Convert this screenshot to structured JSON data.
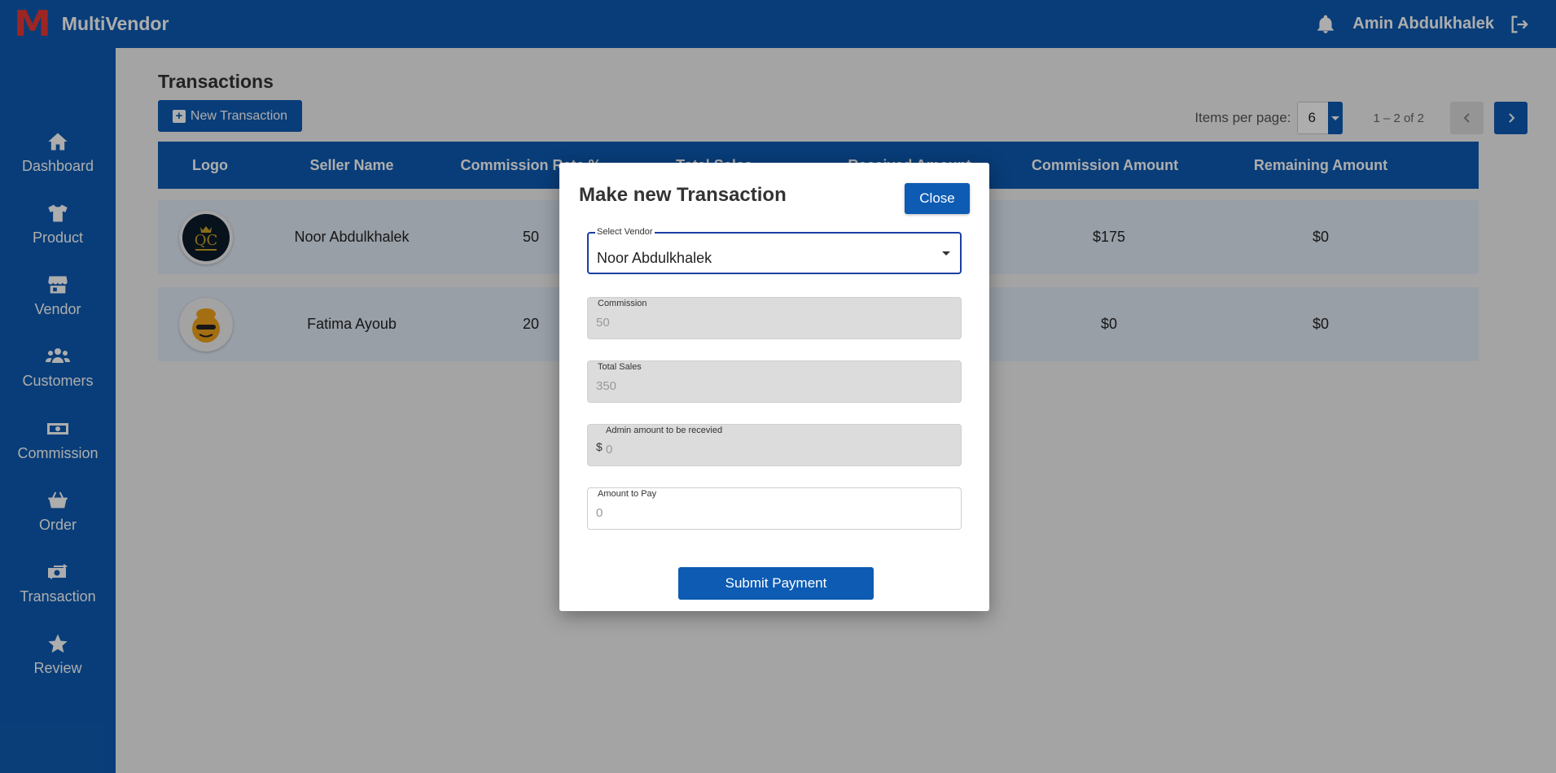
{
  "app": {
    "logo_letter": "M",
    "name": "MultiVendor"
  },
  "header": {
    "user_name": "Amin Abdulkhalek"
  },
  "sidebar": {
    "items": [
      {
        "label": "Dashboard",
        "icon": "home-icon"
      },
      {
        "label": "Product",
        "icon": "shirt-icon"
      },
      {
        "label": "Vendor",
        "icon": "store-icon"
      },
      {
        "label": "Customers",
        "icon": "users-icon"
      },
      {
        "label": "Commission",
        "icon": "money-icon"
      },
      {
        "label": "Order",
        "icon": "basket-icon"
      },
      {
        "label": "Transaction",
        "icon": "money-transfer-icon",
        "active": true
      },
      {
        "label": "Review",
        "icon": "star-icon"
      }
    ]
  },
  "page": {
    "title": "Transactions",
    "new_button": "New Transaction",
    "pager": {
      "items_label": "Items per page:",
      "items_value": "6",
      "range": "1 – 2 of 2"
    }
  },
  "table": {
    "headers": [
      "Logo",
      "Seller Name",
      "Commission Rate %",
      "Total Sales",
      "Received Amount",
      "Commission Amount",
      "Remaining Amount"
    ],
    "rows": [
      {
        "seller": "Noor Abdulkhalek",
        "rate": "50",
        "commission_amount": "$175",
        "remaining": "$0"
      },
      {
        "seller": "Fatima Ayoub",
        "rate": "20",
        "commission_amount": "$0",
        "remaining": "$0"
      }
    ]
  },
  "modal": {
    "title": "Make new Transaction",
    "close": "Close",
    "vendor": {
      "label": "Select Vendor",
      "value": "Noor Abdulkhalek"
    },
    "commission": {
      "label": "Commission",
      "value": "50"
    },
    "total_sales": {
      "label": "Total Sales",
      "value": "350"
    },
    "admin_amount": {
      "label": "Admin amount to be recevied",
      "prefix": "$",
      "value": "0"
    },
    "amount_to_pay": {
      "label": "Amount to Pay",
      "value": "0"
    },
    "submit": "Submit Payment"
  },
  "colors": {
    "primary": "#0d5bb3",
    "brand_red": "#e53935",
    "row_bg": "#e2eaf6"
  }
}
